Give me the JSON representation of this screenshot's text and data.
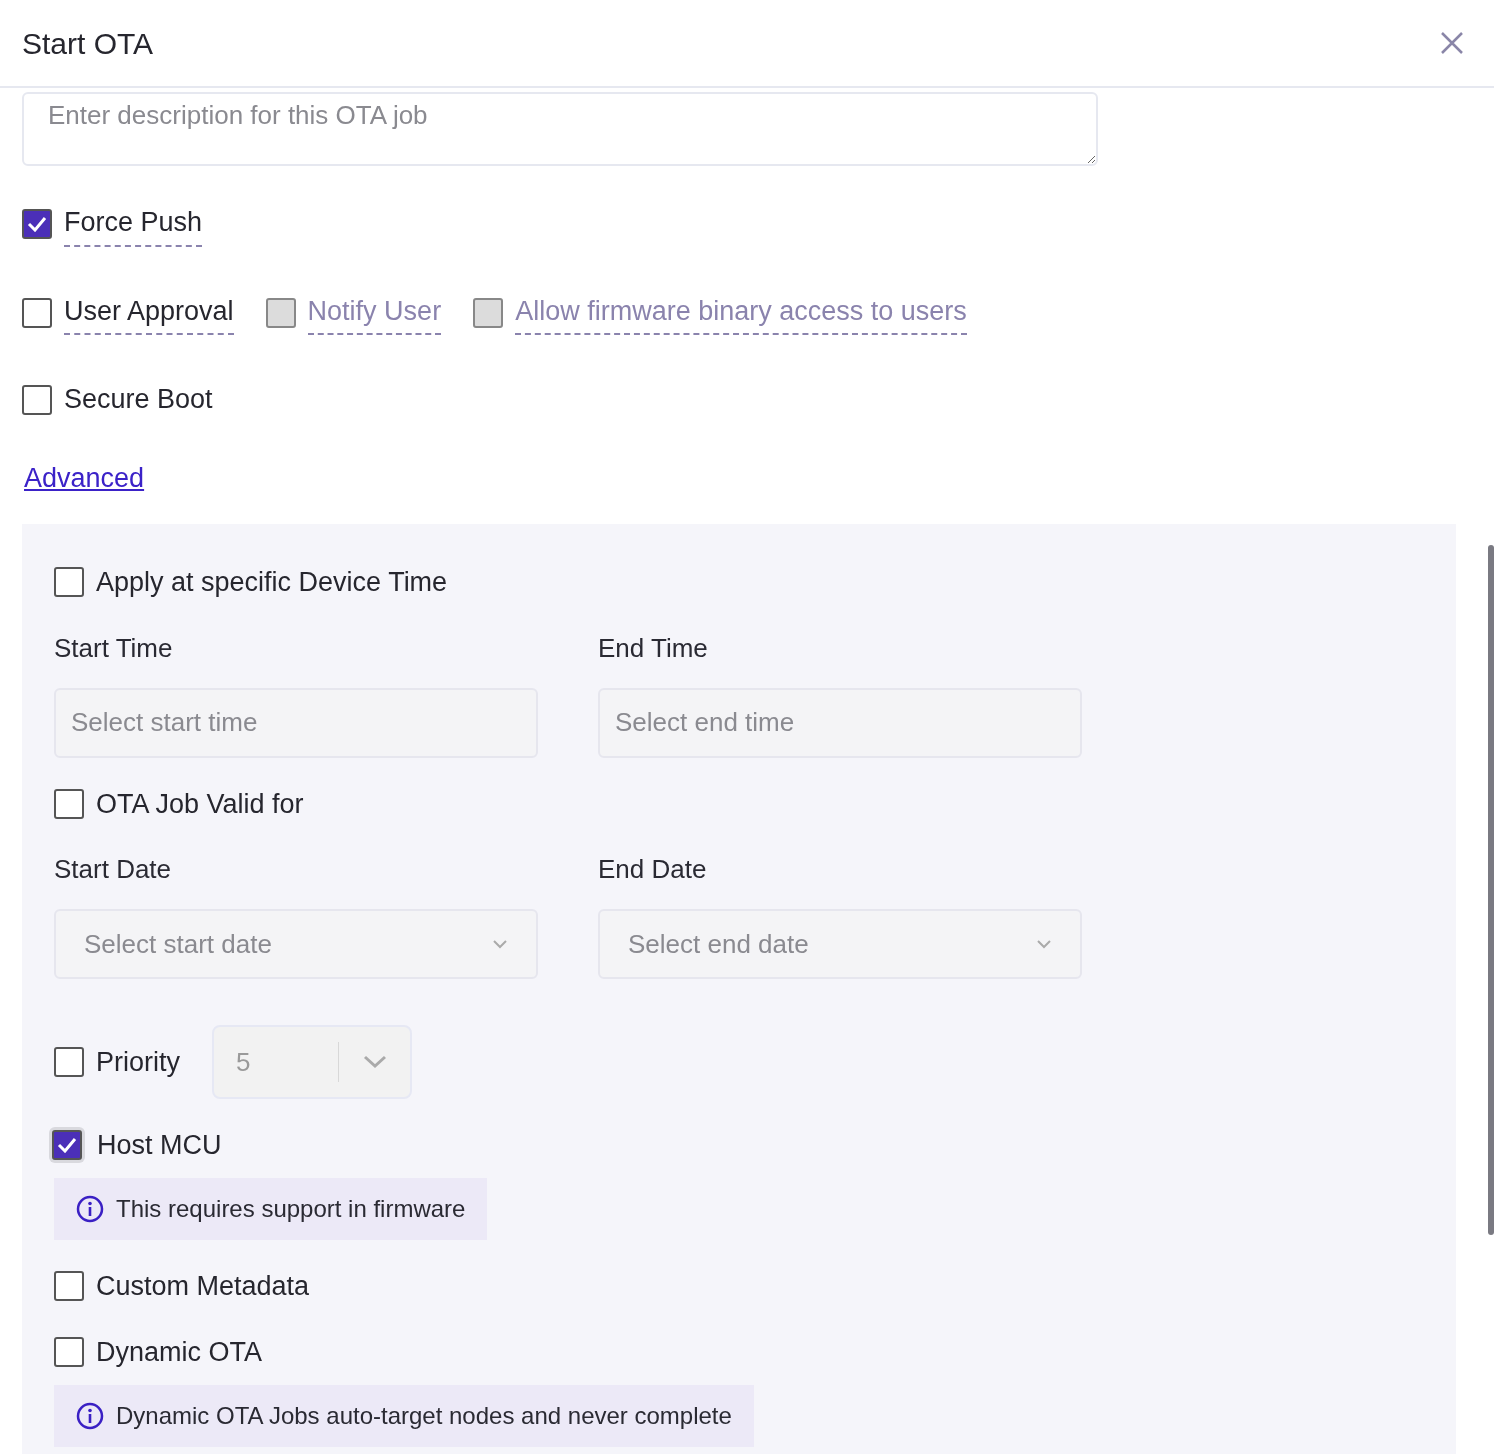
{
  "dialog": {
    "title": "Start OTA"
  },
  "description": {
    "placeholder": "Enter description for this OTA job"
  },
  "options": [
    [
      {
        "label": "Force Push",
        "checked": true,
        "disabled": false,
        "hint_underline": true
      }
    ],
    [
      {
        "label": "User Approval",
        "checked": false,
        "disabled": false,
        "hint_underline": true
      },
      {
        "label": "Notify User",
        "checked": false,
        "disabled": true,
        "hint_underline": true
      },
      {
        "label": "Allow firmware binary access to users",
        "checked": false,
        "disabled": true,
        "hint_underline": true
      }
    ],
    [
      {
        "label": "Secure Boot",
        "checked": false,
        "disabled": false,
        "hint_underline": false
      }
    ]
  ],
  "advanced_link": "Advanced",
  "advanced": [
    {
      "kind": "check",
      "label": "Apply at specific Device Time",
      "checked": false,
      "focused": false
    },
    {
      "kind": "pair",
      "fields": [
        {
          "label": "Start Time",
          "placeholder": "Select start time",
          "dropdown": false
        },
        {
          "label": "End Time",
          "placeholder": "Select end time",
          "dropdown": false
        }
      ]
    },
    {
      "kind": "check",
      "label": "OTA Job Valid for",
      "checked": false,
      "focused": false
    },
    {
      "kind": "pair",
      "fields": [
        {
          "label": "Start Date",
          "placeholder": "Select start date",
          "dropdown": true
        },
        {
          "label": "End Date",
          "placeholder": "Select end date",
          "dropdown": true
        }
      ]
    },
    {
      "kind": "select",
      "label": "Priority",
      "checked": false,
      "value": "5"
    },
    {
      "kind": "check",
      "label": "Host MCU",
      "checked": true,
      "focused": true
    },
    {
      "kind": "info",
      "text": "This requires support in firmware"
    },
    {
      "kind": "check",
      "label": "Custom Metadata",
      "checked": false,
      "focused": false
    },
    {
      "kind": "check",
      "label": "Dynamic OTA",
      "checked": false,
      "focused": false
    },
    {
      "kind": "info",
      "text": "Dynamic OTA Jobs auto-target nodes and never complete"
    }
  ]
}
